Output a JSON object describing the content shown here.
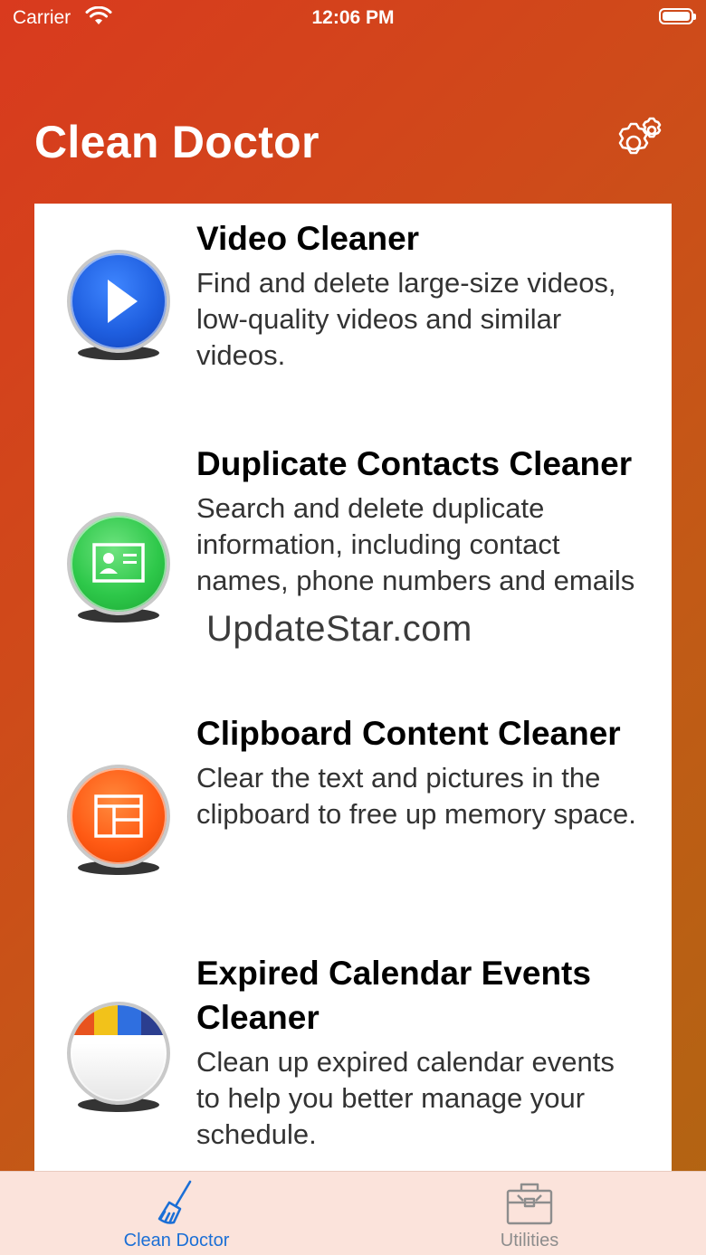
{
  "status_bar": {
    "carrier": "Carrier",
    "time": "12:06 PM"
  },
  "header": {
    "title": "Clean Doctor"
  },
  "features": [
    {
      "title": "Video Cleaner",
      "description": "Find and delete large-size videos, low-quality videos and similar videos.",
      "icon": "play-icon",
      "color": "#1f5fe0"
    },
    {
      "title": "Duplicate Contacts Cleaner",
      "description": "Search and delete duplicate information, including contact names, phone numbers and emails",
      "icon": "contact-card-icon",
      "color": "#2ec84a"
    },
    {
      "title": "Clipboard Content Cleaner",
      "description": "Clear the text and pictures in the clipboard to free up memory space.",
      "icon": "clipboard-layout-icon",
      "color": "#ff5a14"
    },
    {
      "title": "Expired Calendar Events Cleaner",
      "description": "Clean up expired calendar events to help you better manage your schedule.",
      "icon": "calendar-icon",
      "color": "#ffffff"
    }
  ],
  "watermark": "UpdateStar.com",
  "tabs": [
    {
      "label": "Clean Doctor",
      "icon": "broom-icon",
      "active": true
    },
    {
      "label": "Utilities",
      "icon": "toolbox-icon",
      "active": false
    }
  ],
  "colors": {
    "accent": "#1b6fd6",
    "header_gradient_start": "#d93a1e",
    "header_gradient_end": "#b16512",
    "tabbar_bg": "#fbe3db"
  }
}
